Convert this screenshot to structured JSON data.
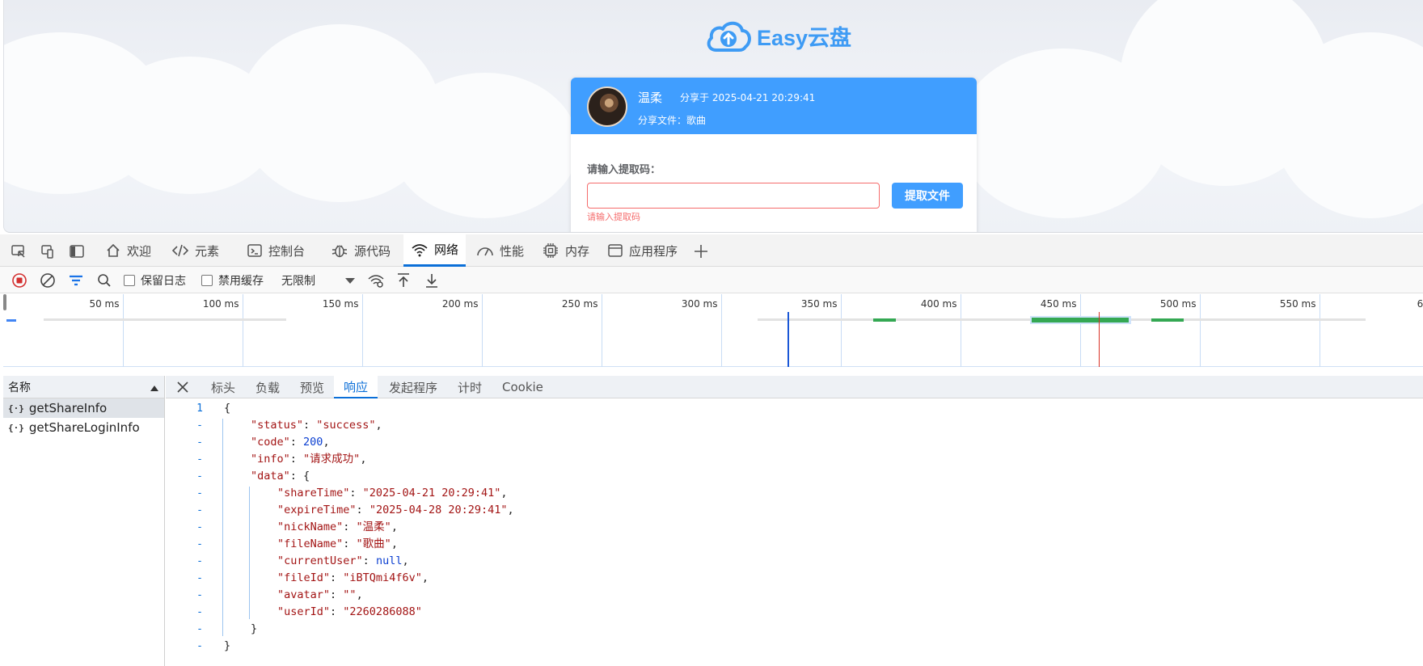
{
  "page": {
    "brand": "Easy云盘",
    "card": {
      "nick_name": "温柔",
      "share_time": "分享于 2025-04-21 20:29:41",
      "share_file": "分享文件：歌曲",
      "code_label": "请输入提取码：",
      "code_value": "",
      "button": "提取文件",
      "error": "请输入提取码"
    }
  },
  "devtools": {
    "tabs": [
      {
        "label": "欢迎",
        "icon": "home-icon"
      },
      {
        "label": "元素",
        "icon": "code-icon"
      },
      {
        "label": "控制台",
        "icon": "console-icon"
      },
      {
        "label": "源代码",
        "icon": "bug-icon"
      },
      {
        "label": "网络",
        "icon": "wifi-icon",
        "active": true
      },
      {
        "label": "性能",
        "icon": "gauge-icon"
      },
      {
        "label": "内存",
        "icon": "chip-icon"
      },
      {
        "label": "应用程序",
        "icon": "window-icon"
      }
    ],
    "toolbar": {
      "preserve_log": "保留日志",
      "disable_cache": "禁用缓存",
      "throttle": "无限制"
    },
    "timeline": {
      "ticks": [
        "50 ms",
        "100 ms",
        "150 ms",
        "200 ms",
        "250 ms",
        "300 ms",
        "350 ms",
        "400 ms",
        "450 ms",
        "500 ms",
        "550 ms",
        "600"
      ]
    },
    "requests": {
      "header": "名称",
      "items": [
        "getShareInfo",
        "getShareLoginInfo"
      ]
    },
    "detail_tabs": [
      "标头",
      "负载",
      "预览",
      "响应",
      "发起程序",
      "计时",
      "Cookie"
    ],
    "response": {
      "status": "success",
      "code": 200,
      "info": "请求成功",
      "data": {
        "shareTime": "2025-04-21 20:29:41",
        "expireTime": "2025-04-28 20:29:41",
        "nickName": "温柔",
        "fileName": "歌曲",
        "currentUser": null,
        "fileId": "iBTQmi4f6v",
        "avatar": "",
        "userId": "2260286088"
      }
    }
  },
  "colors": {
    "brand": "#409eff",
    "error": "#f56c6c",
    "devtools_accent": "#0b6fd8"
  }
}
